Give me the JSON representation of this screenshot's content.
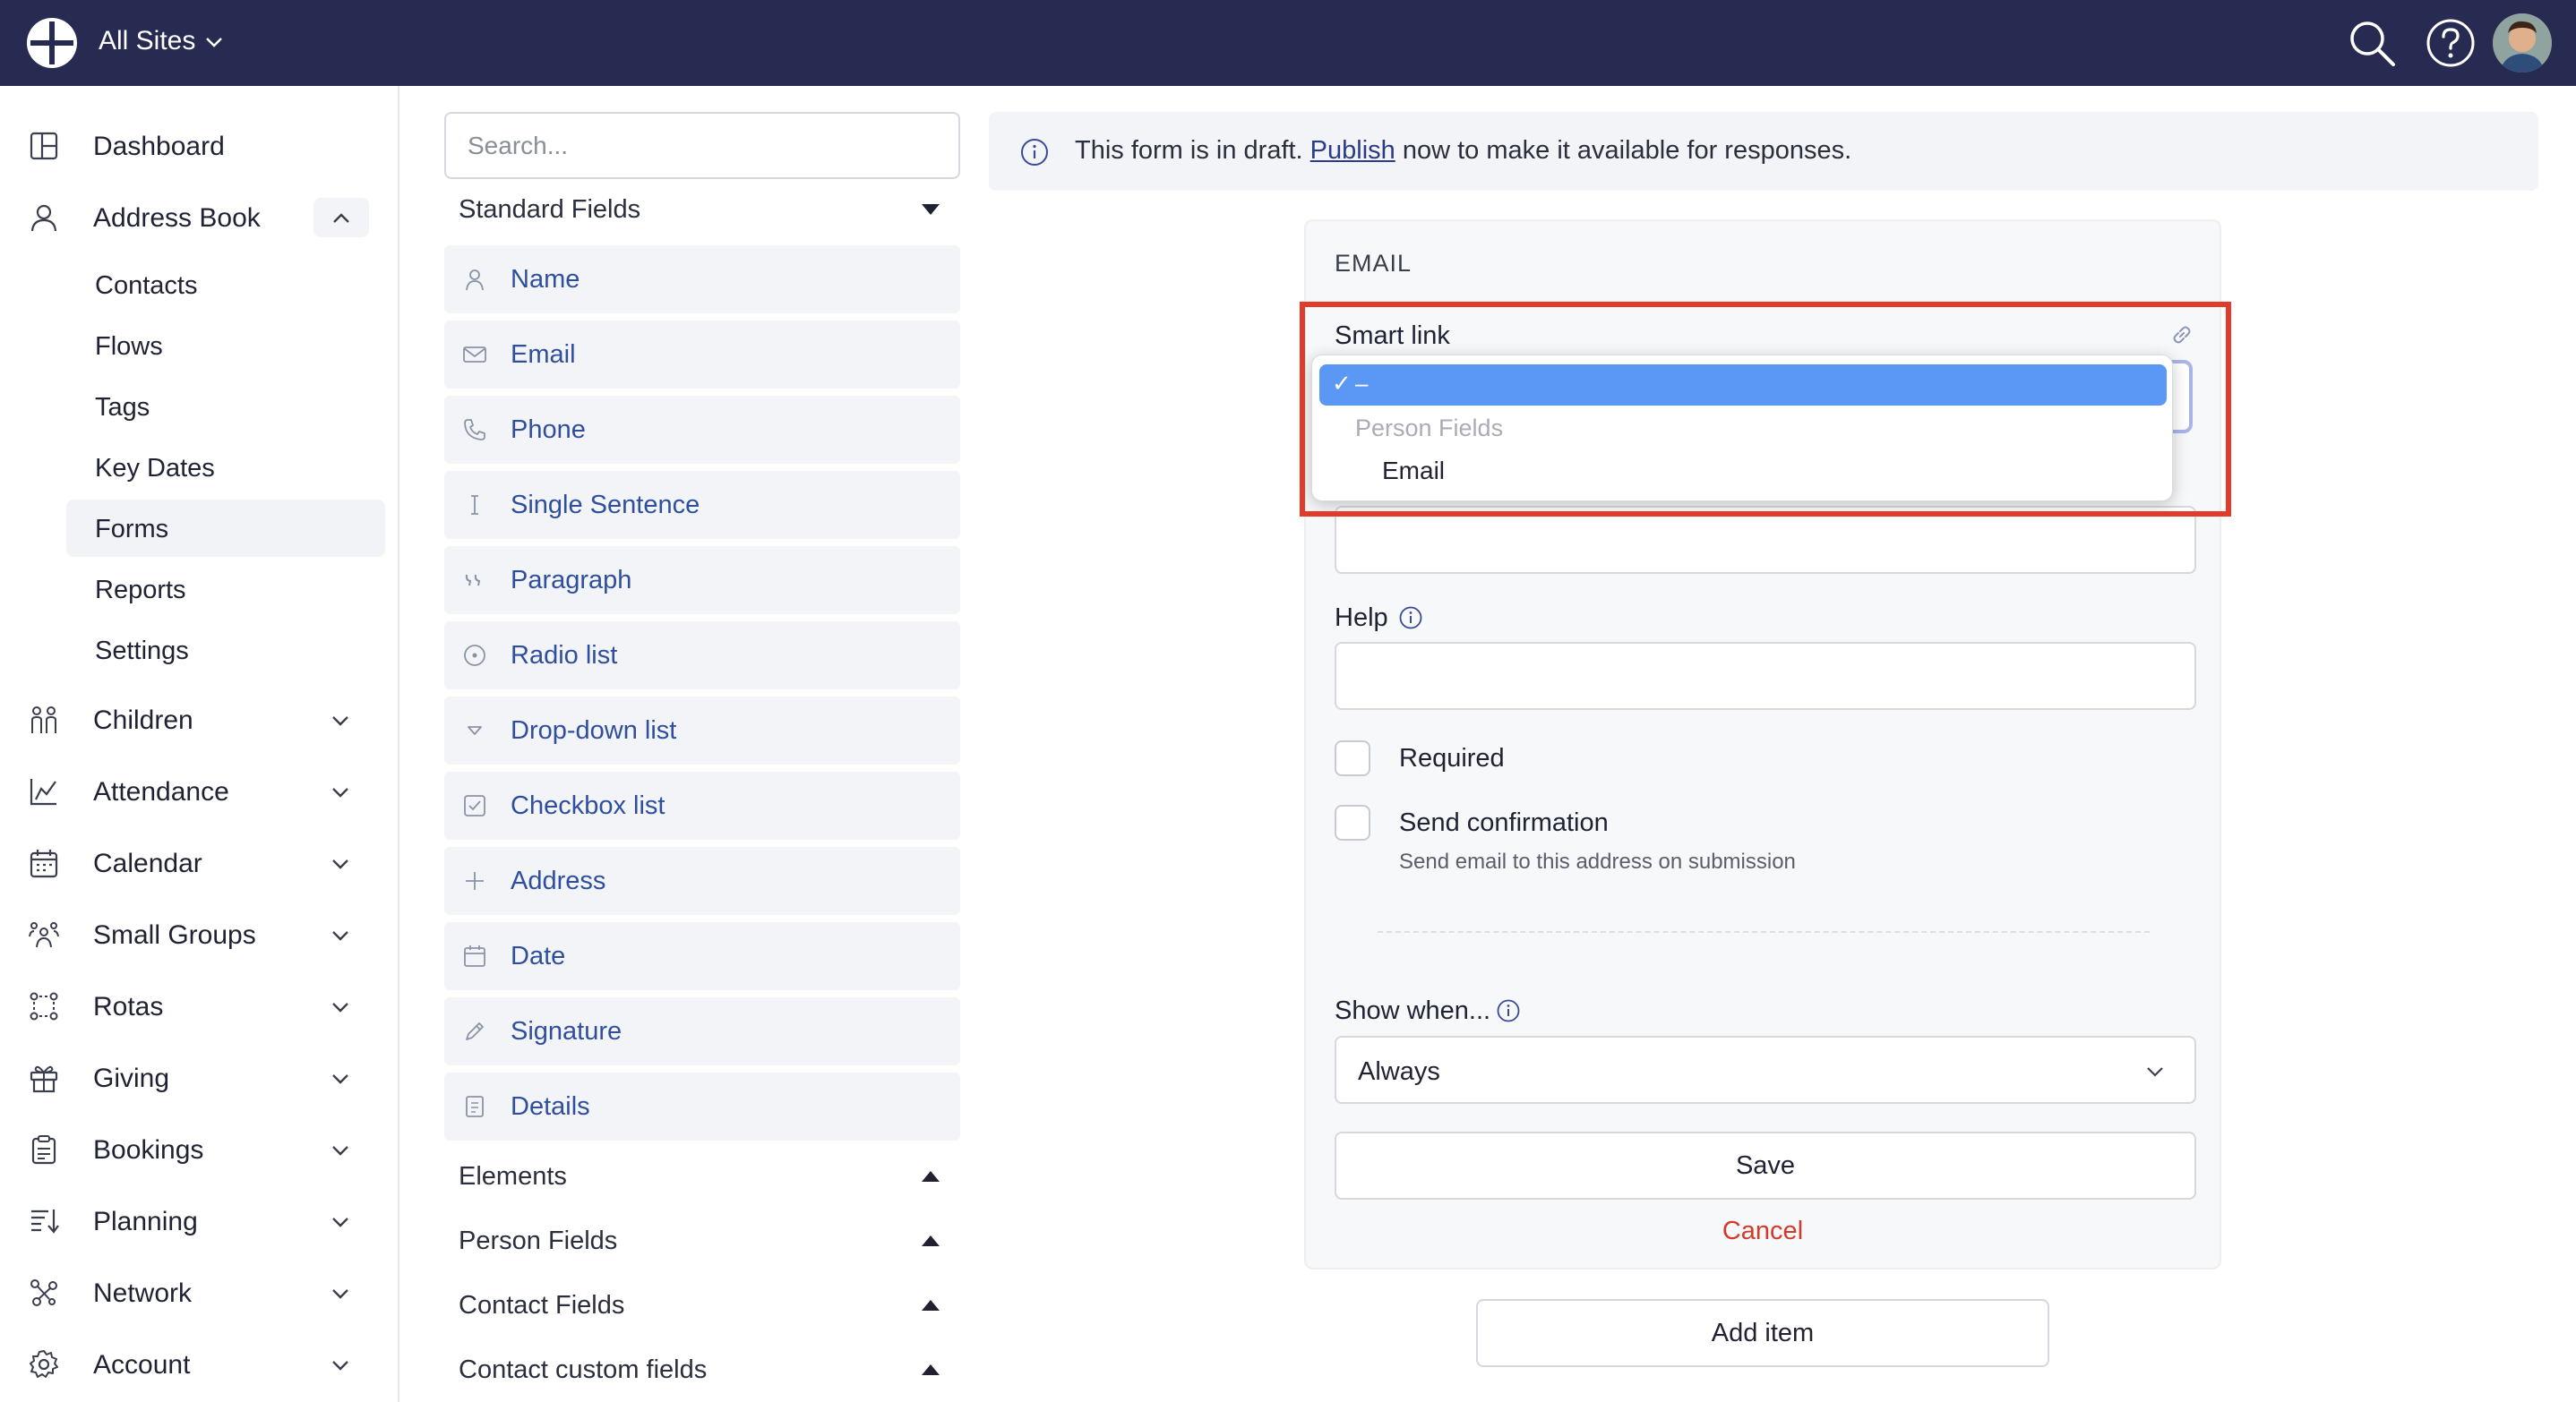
{
  "topbar": {
    "site_label": "All Sites",
    "icons": [
      "globe-logo-icon",
      "chevron-down-icon",
      "search-icon",
      "help-icon",
      "user-avatar"
    ]
  },
  "sidebar": {
    "items": [
      {
        "label": "Dashboard",
        "icon": "dashboard-icon"
      },
      {
        "label": "Address Book",
        "icon": "person-icon",
        "expanded": true
      },
      {
        "label": "Children",
        "icon": "children-icon"
      },
      {
        "label": "Attendance",
        "icon": "chart-icon"
      },
      {
        "label": "Calendar",
        "icon": "calendar-icon"
      },
      {
        "label": "Small Groups",
        "icon": "group-icon"
      },
      {
        "label": "Rotas",
        "icon": "rotas-icon"
      },
      {
        "label": "Giving",
        "icon": "gift-icon"
      },
      {
        "label": "Bookings",
        "icon": "clipboard-icon"
      },
      {
        "label": "Planning",
        "icon": "planning-icon"
      },
      {
        "label": "Network",
        "icon": "network-icon"
      },
      {
        "label": "Account",
        "icon": "gear-icon"
      }
    ],
    "subitems": [
      {
        "label": "Contacts"
      },
      {
        "label": "Flows"
      },
      {
        "label": "Tags"
      },
      {
        "label": "Key Dates"
      },
      {
        "label": "Forms",
        "active": true
      },
      {
        "label": "Reports"
      },
      {
        "label": "Settings"
      }
    ]
  },
  "palette": {
    "search_placeholder": "Search...",
    "standard_header": "Standard Fields",
    "fields": [
      {
        "label": "Name",
        "icon": "person-icon"
      },
      {
        "label": "Email",
        "icon": "envelope-icon"
      },
      {
        "label": "Phone",
        "icon": "phone-icon"
      },
      {
        "label": "Single Sentence",
        "icon": "text-cursor-icon"
      },
      {
        "label": "Paragraph",
        "icon": "quote-icon"
      },
      {
        "label": "Radio list",
        "icon": "radio-icon"
      },
      {
        "label": "Drop-down list",
        "icon": "triangle-down-icon"
      },
      {
        "label": "Checkbox list",
        "icon": "checkbox-icon"
      },
      {
        "label": "Address",
        "icon": "plus-icon"
      },
      {
        "label": "Date",
        "icon": "calendar-icon"
      },
      {
        "label": "Signature",
        "icon": "pencil-icon"
      },
      {
        "label": "Details",
        "icon": "details-icon"
      }
    ],
    "groups": [
      {
        "label": "Elements"
      },
      {
        "label": "Person Fields"
      },
      {
        "label": "Contact Fields"
      },
      {
        "label": "Contact custom fields"
      }
    ]
  },
  "draft_notice": {
    "before": "This form is in draft. ",
    "link": "Publish",
    "after": " now to make it available for responses."
  },
  "editor": {
    "field_type": "EMAIL",
    "smart_link_label": "Smart link",
    "dropdown": {
      "selected": "–",
      "group_label": "Person Fields",
      "options": [
        "Email"
      ]
    },
    "help_label": "Help",
    "required_label": "Required",
    "required_checked": false,
    "send_confirmation_label": "Send confirmation",
    "send_confirmation_checked": false,
    "send_confirmation_hint": "Send email to this address on submission",
    "show_when_label": "Show when...",
    "show_when_value": "Always",
    "save_label": "Save",
    "cancel_label": "Cancel"
  },
  "add_item_label": "Add item",
  "colors": {
    "topbar": "#272b52",
    "link_blue": "#2f4f9e",
    "selected_option": "#5b97f4",
    "cancel_red": "#d23a2a",
    "highlight_red": "#e13b2b"
  }
}
